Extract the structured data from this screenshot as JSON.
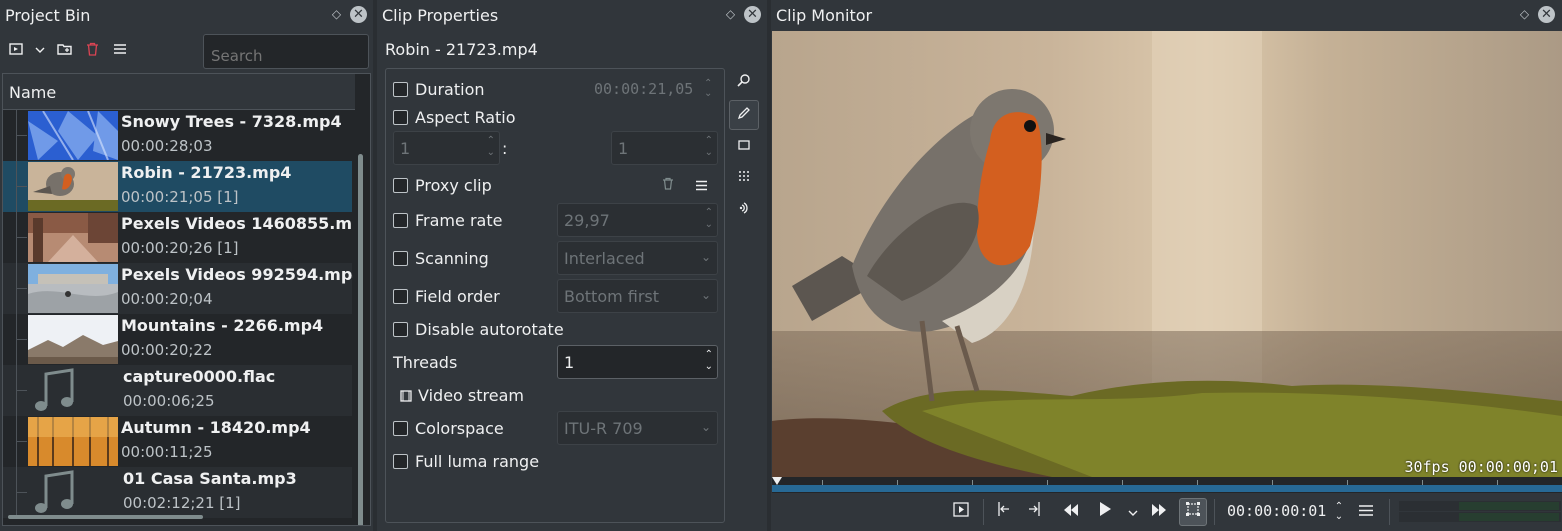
{
  "project_bin": {
    "title": "Project Bin",
    "float_icon": "◇",
    "close_icon": "✕",
    "search_placeholder": "Search",
    "column_name": "Name",
    "clips": [
      {
        "name": "Snowy Trees - 7328.mp4",
        "duration": "00:00:28;03",
        "thumb": "snow"
      },
      {
        "name": "Robin - 21723.mp4",
        "duration": "00:00:21;05 [1]",
        "thumb": "robin",
        "selected": true
      },
      {
        "name": "Pexels Videos 1460855.mp4",
        "duration": "00:00:20;26 [1]",
        "thumb": "street"
      },
      {
        "name": "Pexels Videos 992594.mp4",
        "duration": "00:00:20;04",
        "thumb": "skate"
      },
      {
        "name": "Mountains - 2266.mp4",
        "duration": "00:00:20;22",
        "thumb": "mountain"
      },
      {
        "name": "capture0000.flac",
        "duration": "00:00:06;25",
        "thumb": "audio"
      },
      {
        "name": "Autumn - 18420.mp4",
        "duration": "00:00:11;25",
        "thumb": "autumn"
      },
      {
        "name": "01 Casa Santa.mp3",
        "duration": "00:02:12;21 [1]",
        "thumb": "audio"
      }
    ]
  },
  "clip_properties": {
    "title": "Clip Properties",
    "clip_name": "Robin - 21723.mp4",
    "duration_label": "Duration",
    "duration_value": "00:00:21,05",
    "aspect_ratio_label": "Aspect Ratio",
    "aspect_num": "1",
    "aspect_sep": ":",
    "aspect_den": "1",
    "proxy_label": "Proxy clip",
    "frame_rate_label": "Frame rate",
    "frame_rate_value": "29,97",
    "scanning_label": "Scanning",
    "scanning_value": "Interlaced",
    "field_order_label": "Field order",
    "field_order_value": "Bottom first",
    "autorotate_label": "Disable autorotate",
    "threads_label": "Threads",
    "threads_value": "1",
    "video_stream_label": "Video stream",
    "colorspace_label": "Colorspace",
    "colorspace_value": "ITU-R 709",
    "full_luma_label": "Full luma range"
  },
  "clip_monitor": {
    "title": "Clip Monitor",
    "overlay_timecode": "30fps 00:00:00;01",
    "timecode": "00:00:00:01"
  }
}
